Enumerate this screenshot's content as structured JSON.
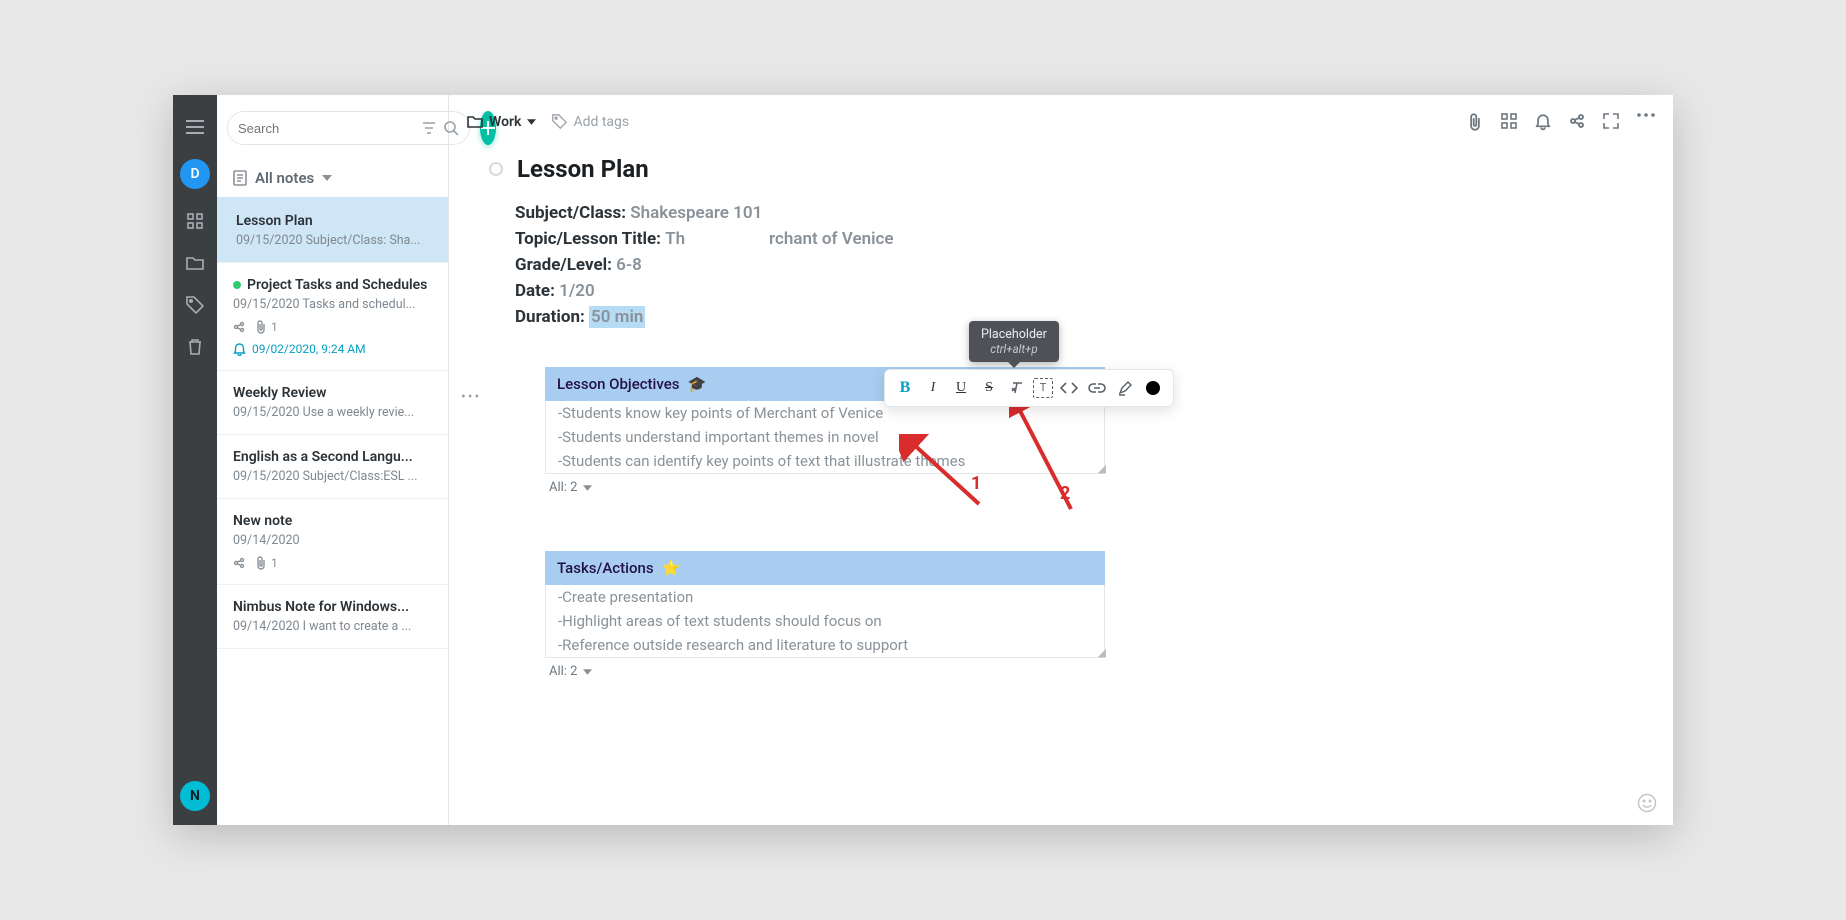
{
  "rail": {
    "avatar_initial": "D",
    "logo_letter": "N"
  },
  "search": {
    "placeholder": "Search"
  },
  "list_header": "All notes",
  "notes": [
    {
      "title": "Lesson Plan",
      "preview": "09/15/2020 Subject/Class: Sha..."
    },
    {
      "title": "Project Tasks and Schedules",
      "preview": "09/15/2020 Tasks and schedul...",
      "attach": "1",
      "alarm": "09/02/2020, 9:24 AM",
      "green": true
    },
    {
      "title": "Weekly Review",
      "preview": "09/15/2020 Use a weekly revie..."
    },
    {
      "title": "English as a Second Langu...",
      "preview": "09/15/2020 Subject/Class:ESL ..."
    },
    {
      "title": "New note",
      "preview": "09/14/2020",
      "attach": "1"
    },
    {
      "title": "Nimbus Note for Windows...",
      "preview": "09/14/2020 I want to create a ..."
    }
  ],
  "topbar": {
    "folder": "Work",
    "add_tags": "Add tags"
  },
  "doc": {
    "title": "Lesson Plan",
    "subject_label": "Subject/Class:",
    "subject_ph": "Shakespeare 101",
    "topic_label": "Topic/Lesson Title:",
    "topic_ph_left": "Th",
    "topic_ph_right": "rchant of Venice",
    "grade_label": "Grade/Level:",
    "grade_ph": "6-8",
    "date_label": "Date:",
    "date_ph": "1/20",
    "duration_label": "Duration:",
    "duration_sel": "50 min",
    "objectives_header": "Lesson Objectives",
    "objectives": [
      "-Students know key points of Merchant of Venice",
      "-Students understand important themes in novel",
      "-Students can identify key points of text that illustrate themes"
    ],
    "block_footer": "All: 2",
    "tasks_header": "Tasks/Actions",
    "tasks": [
      "-Create presentation",
      "-Highlight areas of text students should focus on",
      "-Reference outside research and literature to support"
    ]
  },
  "tooltip": {
    "title": "Placeholder",
    "kbd": "ctrl+alt+p"
  },
  "anno": {
    "n1": "1",
    "n2": "2"
  }
}
